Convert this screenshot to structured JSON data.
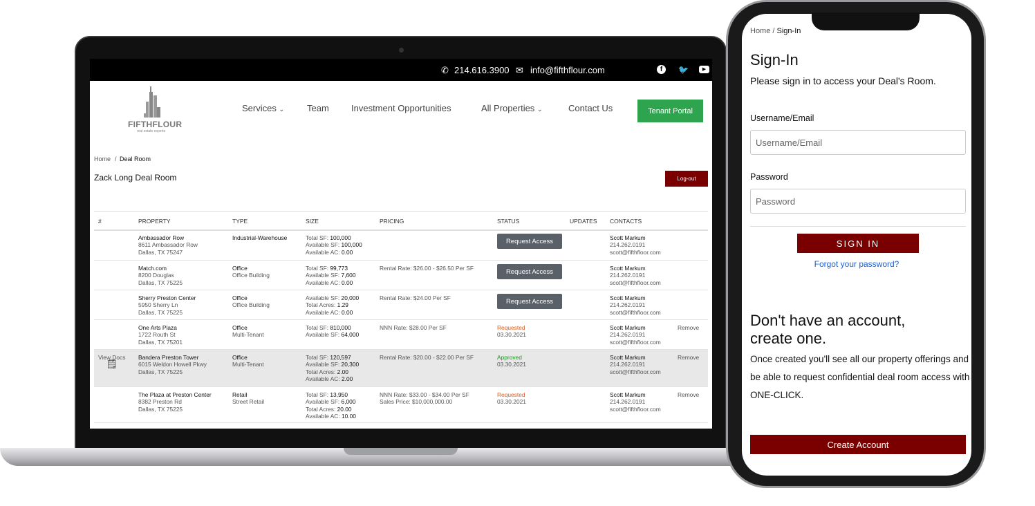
{
  "laptop": {
    "topbar": {
      "phone": "214.616.3900",
      "email": "info@fifthflour.com",
      "social": [
        "facebook-icon",
        "twitter-icon",
        "youtube-icon"
      ]
    },
    "logo": {
      "name": "FIFTHFLOUR",
      "tagline": "real estate experts"
    },
    "nav": [
      {
        "label": "Services",
        "dropdown": true
      },
      {
        "label": "Team"
      },
      {
        "label": "Investment Opportunities"
      },
      {
        "label": "All Properties",
        "dropdown": true
      },
      {
        "label": "Contact Us"
      }
    ],
    "tenant_portal": "Tenant Portal",
    "breadcrumb": {
      "home": "Home",
      "sep": "/",
      "current": "Deal Room"
    },
    "title": "Zack Long Deal Room",
    "logout": "Log-out",
    "columns": [
      "#",
      "PROPERTY",
      "TYPE",
      "SIZE",
      "PRICING",
      "STATUS",
      "UPDATES",
      "CONTACTS"
    ],
    "rows": [
      {
        "num": "",
        "name": "Ambassador Row",
        "addr": "8611 Ambassador Row",
        "city": "Dallas, TX 75247",
        "type": "Industrial-Warehouse",
        "subtype": "",
        "size": [
          [
            "Total SF:",
            "100,000"
          ],
          [
            "Available SF:",
            "100,000"
          ],
          [
            "Available AC:",
            "0.00"
          ]
        ],
        "pricing": [],
        "status": "",
        "date": "",
        "button": "Request Access",
        "contact": [
          "Scott Markum",
          "214.262.0191",
          "scott@fifthfloor.com"
        ],
        "remove": ""
      },
      {
        "num": "",
        "name": "Match.com",
        "addr": "8200 Douglas",
        "city": "Dallas, TX 75225",
        "type": "Office",
        "subtype": "Office Building",
        "size": [
          [
            "Total SF:",
            "99,773"
          ],
          [
            "Available SF:",
            "7,600"
          ],
          [
            "Available AC:",
            "0.00"
          ]
        ],
        "pricing": [
          "Rental Rate: $26.00 - $26.50 Per SF"
        ],
        "status": "",
        "date": "",
        "button": "Request Access",
        "contact": [
          "Scott Markum",
          "214.262.0191",
          "scott@fifthfloor.com"
        ],
        "remove": ""
      },
      {
        "num": "",
        "name": "Sherry Preston Center",
        "addr": "5950 Sherry Ln",
        "city": "Dallas, TX 75225",
        "type": "Office",
        "subtype": "Office Building",
        "size": [
          [
            "Available SF:",
            "20,000"
          ],
          [
            "Total Acres:",
            "1.29"
          ],
          [
            "Available AC:",
            "0.00"
          ]
        ],
        "pricing": [
          "Rental Rate: $24.00 Per SF"
        ],
        "status": "",
        "date": "",
        "button": "Request Access",
        "contact": [
          "Scott Markum",
          "214.262.0191",
          "scott@fifthfloor.com"
        ],
        "remove": ""
      },
      {
        "num": "",
        "name": "One Arts Plaza",
        "addr": "1722 Routh St",
        "city": "Dallas, TX 75201",
        "type": "Office",
        "subtype": "Multi-Tenant",
        "size": [
          [
            "Total SF:",
            "810,000"
          ],
          [
            "Available SF:",
            "64,000"
          ]
        ],
        "pricing": [
          "NNN Rate: $28.00 Per SF"
        ],
        "status": "Requested",
        "date": "03.30.2021",
        "button": "",
        "contact": [
          "Scott Markum",
          "214.262.0191",
          "scott@fifthfloor.com"
        ],
        "remove": "Remove"
      },
      {
        "num": "View Docs",
        "name": "Bandera Preston Tower",
        "addr": "6015 Weldon Howell Pkwy",
        "city": "Dallas, TX 75225",
        "type": "Office",
        "subtype": "Multi-Tenant",
        "size": [
          [
            "Total SF:",
            "120,597"
          ],
          [
            "Available SF:",
            "20,300"
          ],
          [
            "Total Acres:",
            "2.00"
          ],
          [
            "Available AC:",
            "2.00"
          ]
        ],
        "pricing": [
          "Rental Rate: $20.00 - $22.00 Per SF"
        ],
        "status": "Approved",
        "date": "03.30.2021",
        "button": "",
        "contact": [
          "Scott Markum",
          "214.262.0191",
          "scott@fifthfloor.com"
        ],
        "remove": "Remove"
      },
      {
        "num": "",
        "name": "The Plaza at Preston Center",
        "addr": "8382 Preston Rd",
        "city": "Dallas, TX 75225",
        "type": "Retail",
        "subtype": "Street Retail",
        "size": [
          [
            "Total SF:",
            "13,950"
          ],
          [
            "Available SF:",
            "6,000"
          ],
          [
            "Total Acres:",
            "20.00"
          ],
          [
            "Available AC:",
            "10.00"
          ]
        ],
        "pricing": [
          "NNN Rate: $33.00 - $34.00 Per SF",
          "Sales Price: $10,000,000.00"
        ],
        "status": "Requested",
        "date": "03.30.2021",
        "button": "",
        "contact": [
          "Scott Markum",
          "214.262.0191",
          "scott@fifthfloor.com"
        ],
        "remove": "Remove"
      }
    ]
  },
  "phone": {
    "breadcrumb": {
      "home": "Home",
      "sep": "/",
      "current": "Sign-In"
    },
    "title": "Sign-In",
    "subtitle": "Please sign in to access your Deal's Room.",
    "username_label": "Username/Email",
    "username_placeholder": "Username/Email",
    "password_label": "Password",
    "password_placeholder": "Password",
    "signin": "SIGN IN",
    "forgot": "Forgot your password?",
    "heading": "Don't have an account, create one.",
    "body": "Once created you'll see all our property offerings and be able to request confidential deal room access with ONE-CLICK.",
    "create": "Create Account"
  },
  "colors": {
    "brand_red": "#7a0000",
    "tenant_green": "#2ea44f",
    "requested": "#e05a1a",
    "approved": "#1a9a1a"
  }
}
